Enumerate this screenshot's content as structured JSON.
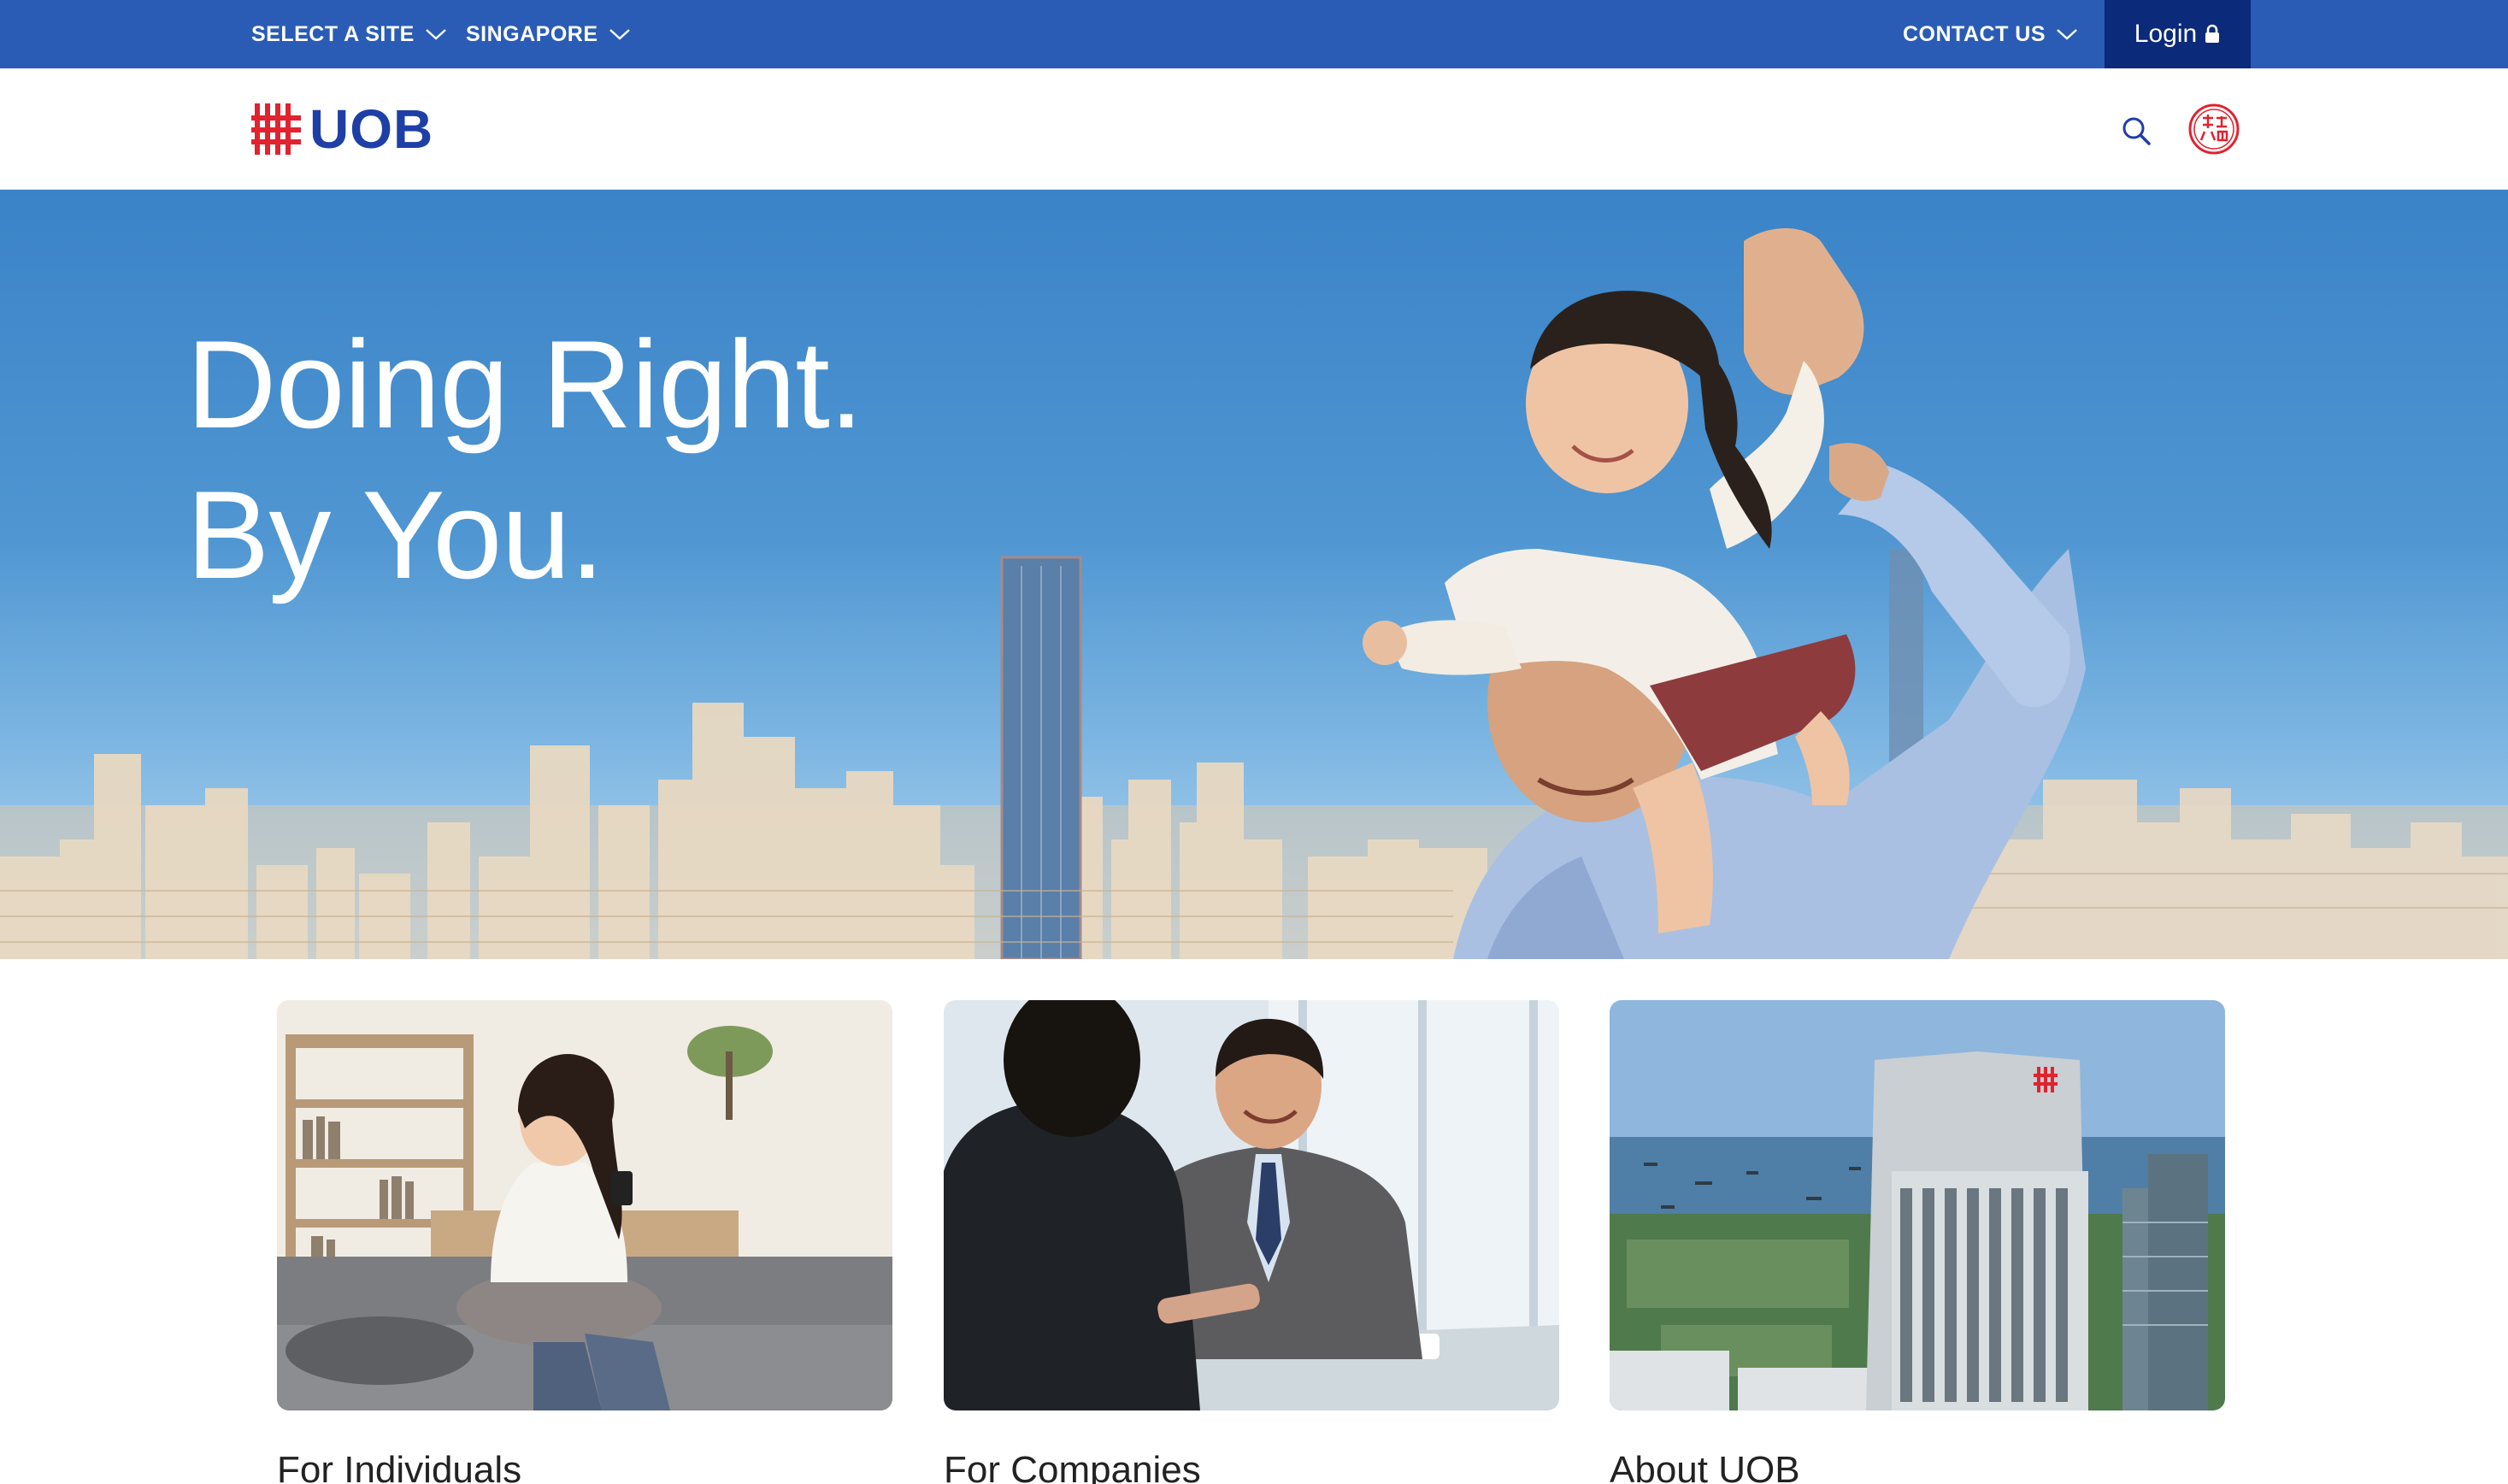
{
  "topbar": {
    "select_site": "SELECT A SITE",
    "region": "SINGAPORE",
    "contact": "CONTACT US",
    "login": "Login"
  },
  "header": {
    "logo_text": "UOB"
  },
  "hero": {
    "line1": "Doing Right.",
    "line2": "By You."
  },
  "cards": [
    {
      "title": "For Individuals"
    },
    {
      "title": "For Companies"
    },
    {
      "title": "About UOB"
    }
  ],
  "colors": {
    "brand_blue": "#2a5cb5",
    "login_bg": "#0b2a7a",
    "logo_red": "#e0232f",
    "logo_blue": "#1e3fa6"
  },
  "icons": [
    "chevron-down-icon",
    "lock-icon",
    "search-icon",
    "chinese-seal-icon"
  ]
}
